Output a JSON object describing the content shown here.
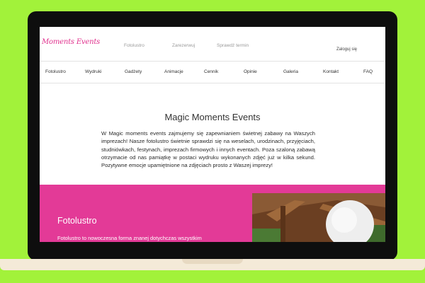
{
  "site": {
    "logo_text": "Moments Events",
    "top_links": [
      "Fotolustro",
      "Zarezerwuj",
      "Sprawdź termin"
    ],
    "login_label": "Zaloguj się"
  },
  "nav": {
    "items": [
      "Fotolustro",
      "Wydruki",
      "Gadżety",
      "Animacje",
      "Cennik",
      "Opinie",
      "Galeria",
      "Kontakt",
      "FAQ"
    ]
  },
  "main": {
    "title": "Magic Moments Events",
    "intro": "W Magic moments events zajmujemy się zapewnianiem świetnej zabawy na Waszych imprezach! Nasze fotolustro świetnie sprawdzi się na weselach, urodzinach, przyjęciach, studniówkach, festynach, imprezach firmowych i innych eventach. Poza szaloną zabawą otrzymacie od nas pamiątkę w postaci wydruku wykonanych zdjęć już w kilka sekund. Pozytywne emocje upamiętnione na zdjęciach prosto z Waszej imprezy!"
  },
  "section": {
    "title": "Fotolustro",
    "text": "Fotolustro to nowoczesna forma znanej dotychczas wszystkim"
  },
  "colors": {
    "background": "#a2f23a",
    "accent": "#e33a97",
    "logo": "#e0308d"
  }
}
